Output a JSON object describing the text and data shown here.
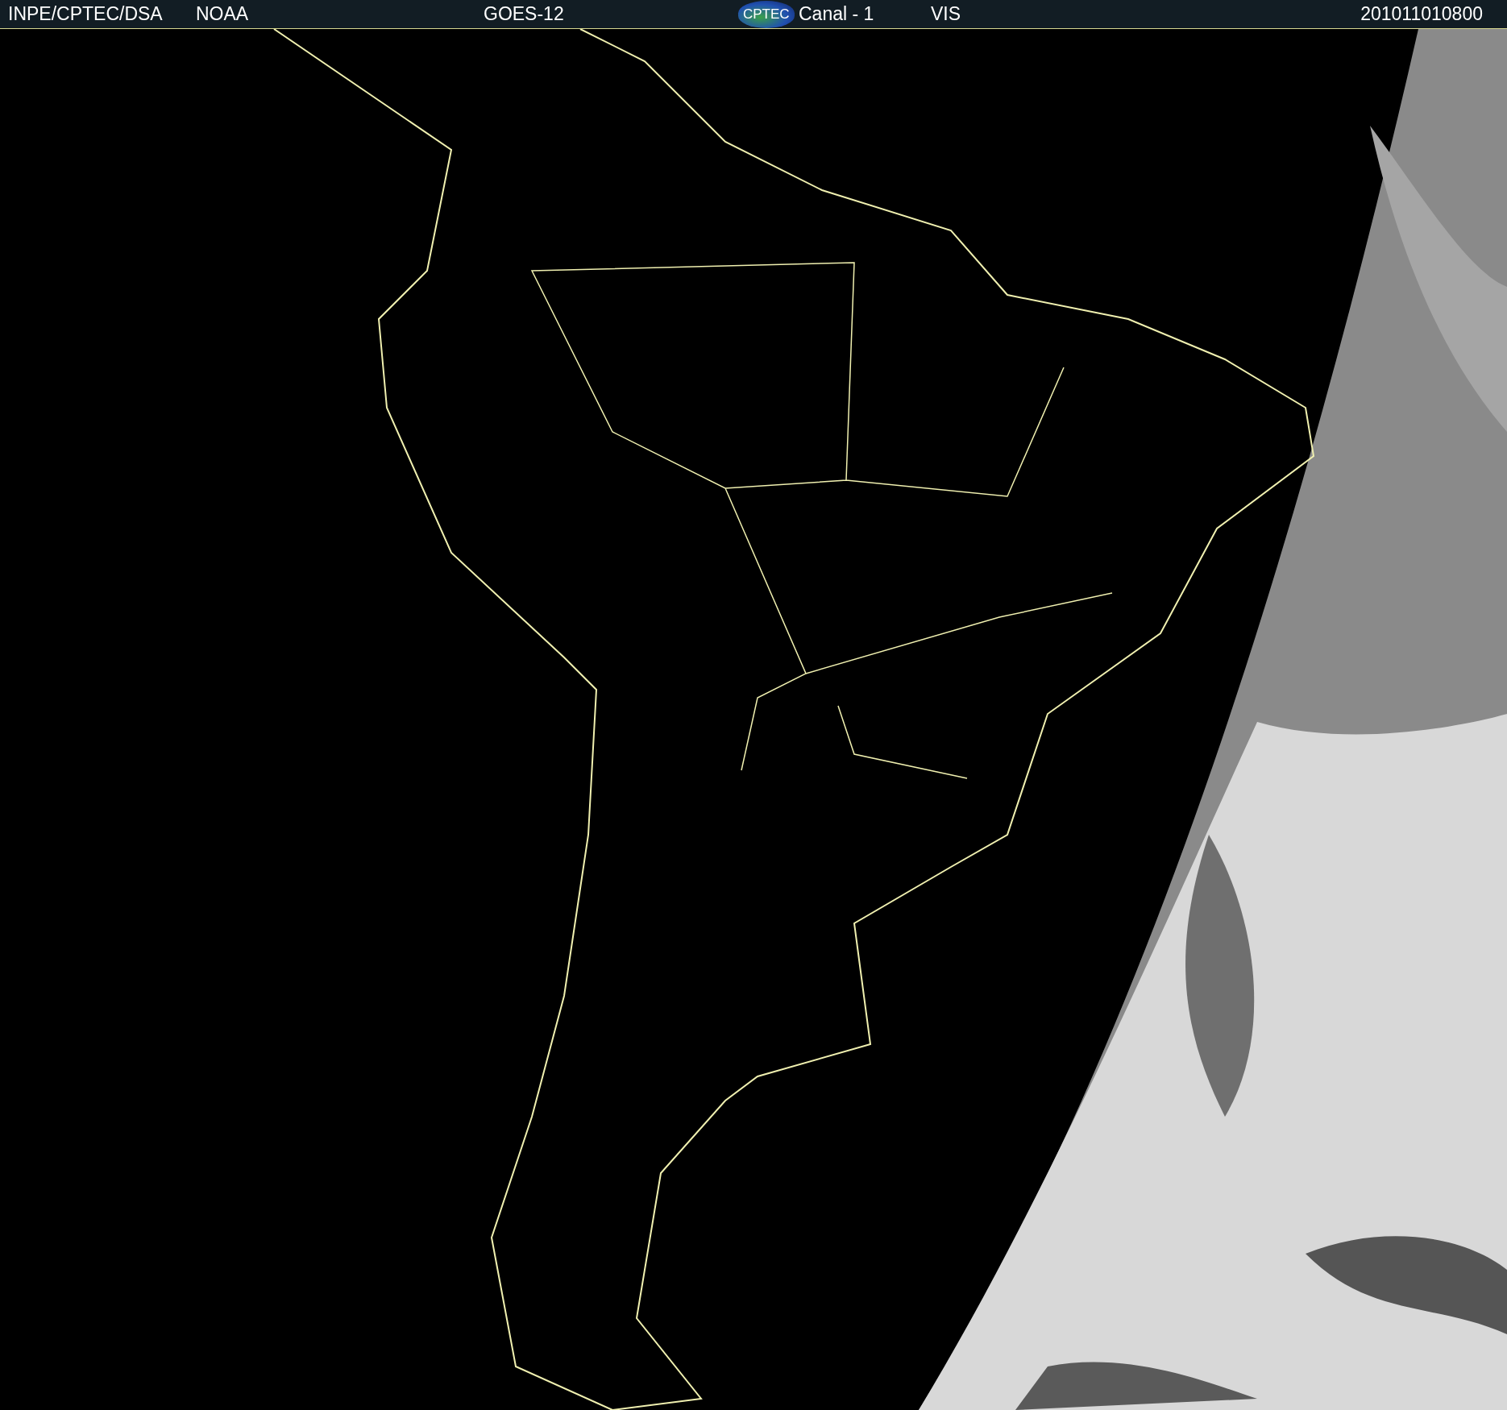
{
  "header": {
    "institution": "INPE/CPTEC/DSA",
    "agency": "NOAA",
    "satellite": "GOES-12",
    "logo": "CPTEC",
    "channel": "Canal - 1",
    "band": "VIS",
    "timestamp": "201011010800"
  }
}
